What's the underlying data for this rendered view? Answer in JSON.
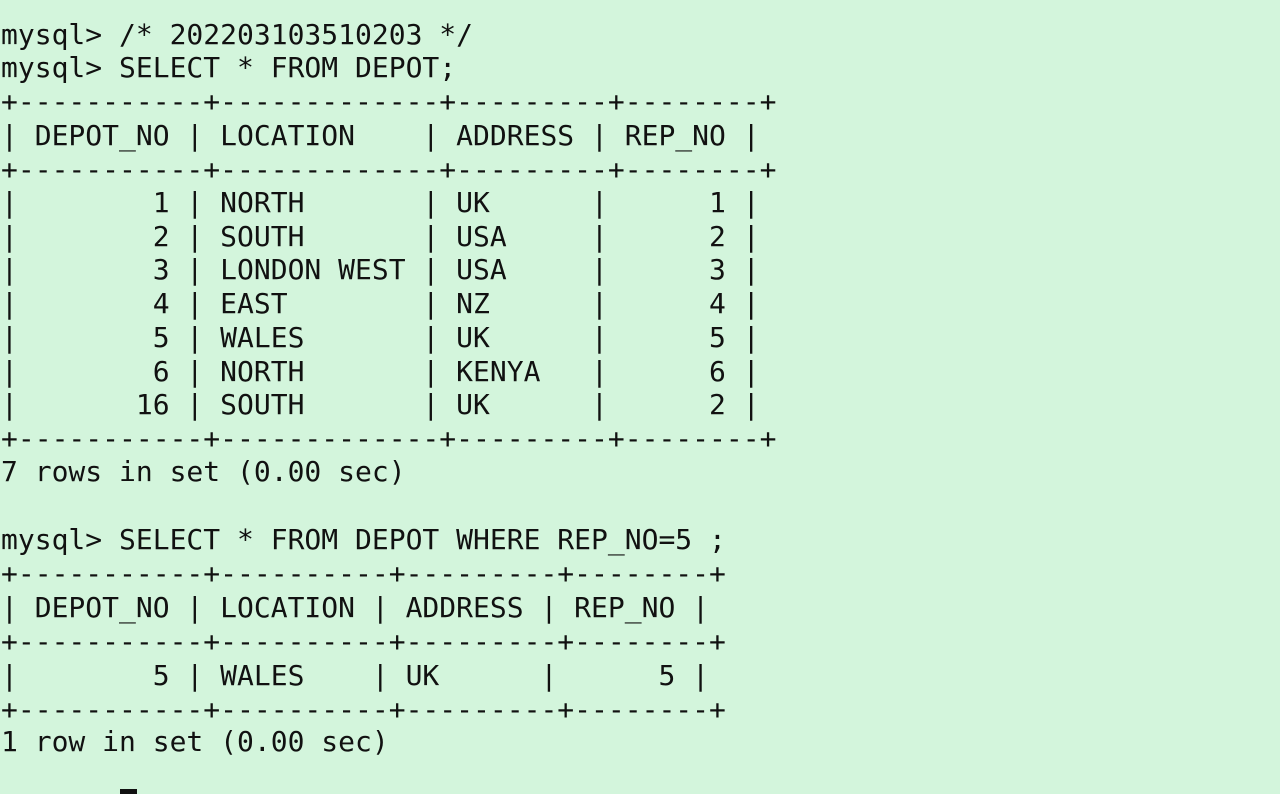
{
  "terminal": {
    "lines": [
      "mysql> /* 202203103510203 */",
      "mysql> SELECT * FROM DEPOT;",
      "+-----------+-------------+---------+--------+",
      "| DEPOT_NO | LOCATION    | ADDRESS | REP_NO |",
      "+-----------+-------------+---------+--------+",
      "|        1 | NORTH       | UK      |      1 |",
      "|        2 | SOUTH       | USA     |      2 |",
      "|        3 | LONDON WEST | USA     |      3 |",
      "|        4 | EAST        | NZ      |      4 |",
      "|        5 | WALES       | UK      |      5 |",
      "|        6 | NORTH       | KENYA   |      6 |",
      "|       16 | SOUTH       | UK      |      2 |",
      "+-----------+-------------+---------+--------+",
      "7 rows in set (0.00 sec)",
      "",
      "mysql> SELECT * FROM DEPOT WHERE REP_NO=5 ;",
      "+-----------+----------+---------+--------+",
      "| DEPOT_NO | LOCATION | ADDRESS | REP_NO |",
      "+-----------+----------+---------+--------+",
      "|        5 | WALES    | UK      |      5 |",
      "+-----------+----------+---------+--------+",
      "1 row in set (0.00 sec)"
    ]
  }
}
